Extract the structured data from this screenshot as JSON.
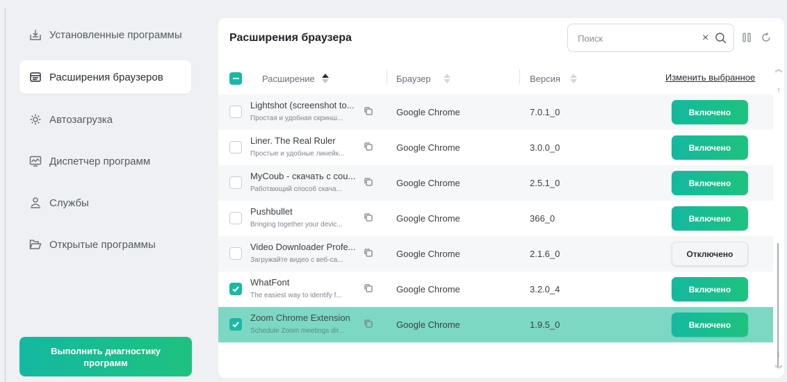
{
  "sidebar": {
    "items": [
      {
        "label": "Установленные программы",
        "icon": "installed-programs-icon"
      },
      {
        "label": "Расширения браузеров",
        "icon": "browser-extensions-icon"
      },
      {
        "label": "Автозагрузка",
        "icon": "autostart-icon"
      },
      {
        "label": "Диспетчер программ",
        "icon": "program-manager-icon"
      },
      {
        "label": "Службы",
        "icon": "services-icon"
      },
      {
        "label": "Открытые программы",
        "icon": "open-programs-icon"
      }
    ],
    "active_index": 1,
    "diagnostics_line1": "Выполнить диагностику",
    "diagnostics_line2": "программ"
  },
  "panel": {
    "title": "Расширения браузера",
    "search_placeholder": "Поиск",
    "search_value": "",
    "clear_symbol": "×"
  },
  "table": {
    "columns": {
      "extension": "Расширение",
      "browser": "Браузер",
      "version": "Версия"
    },
    "edit_selected": "Изменить выбранное",
    "rows": [
      {
        "name": "Lightshot (screenshot to...",
        "desc": "Простая и удобная скринш...",
        "browser": "Google Chrome",
        "version": "7.0.1_0",
        "status": "Включено",
        "enabled": true,
        "checked": false,
        "selected": false
      },
      {
        "name": "Liner. The Real Ruler",
        "desc": "Простые и удобные линейк...",
        "browser": "Google Chrome",
        "version": "3.0.0_0",
        "status": "Включено",
        "enabled": true,
        "checked": false,
        "selected": false
      },
      {
        "name": "MyCoub - скачать с cou...",
        "desc": "Работающий способ скача...",
        "browser": "Google Chrome",
        "version": "2.5.1_0",
        "status": "Включено",
        "enabled": true,
        "checked": false,
        "selected": false
      },
      {
        "name": "Pushbullet",
        "desc": "Bringing together your devic...",
        "browser": "Google Chrome",
        "version": "366_0",
        "status": "Включено",
        "enabled": true,
        "checked": false,
        "selected": false
      },
      {
        "name": "Video Downloader Profe...",
        "desc": "Загружайте видео с веб-са...",
        "browser": "Google Chrome",
        "version": "2.1.6_0",
        "status": "Отключено",
        "enabled": false,
        "checked": false,
        "selected": false
      },
      {
        "name": "WhatFont",
        "desc": "The easiest way to identify f...",
        "browser": "Google Chrome",
        "version": "3.2.0_4",
        "status": "Включено",
        "enabled": true,
        "checked": true,
        "selected": false
      },
      {
        "name": "Zoom Chrome Extension",
        "desc": "Schedule Zoom meetings dir...",
        "browser": "Google Chrome",
        "version": "1.9.5_0",
        "status": "Включено",
        "enabled": true,
        "checked": true,
        "selected": true
      }
    ]
  },
  "colors": {
    "accent": "#19b9a4",
    "selected_row": "#7dd8c3",
    "background": "#eef0f3"
  }
}
